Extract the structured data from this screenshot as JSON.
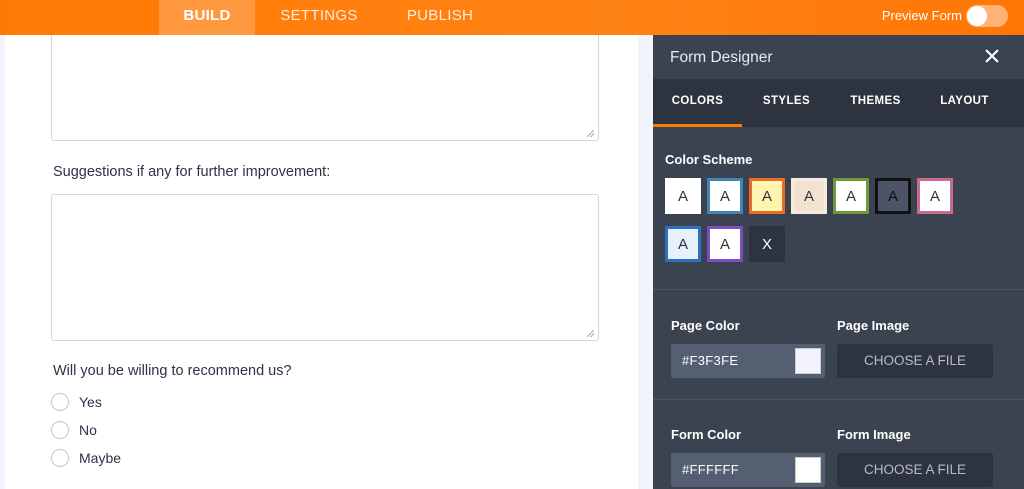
{
  "topbar": {
    "tabs": [
      {
        "label": "BUILD",
        "active": true
      },
      {
        "label": "SETTINGS",
        "active": false
      },
      {
        "label": "PUBLISH",
        "active": false
      }
    ],
    "preview_label": "Preview Form",
    "preview_enabled": false,
    "accent_color": "#ff7a05"
  },
  "form": {
    "page_background": "#f3f3fe",
    "questions": [
      {
        "label": "Suggestions if any for further improvement:",
        "type": "textarea"
      },
      {
        "label": "Will you be willing to recommend us?",
        "type": "radio",
        "options": [
          "Yes",
          "No",
          "Maybe"
        ]
      }
    ]
  },
  "designer": {
    "title": "Form Designer",
    "close_icon": "close-icon",
    "tabs": [
      {
        "label": "COLORS",
        "active": true
      },
      {
        "label": "STYLES",
        "active": false
      },
      {
        "label": "THEMES",
        "active": false
      },
      {
        "label": "LAYOUT",
        "active": false
      }
    ],
    "color_scheme": {
      "label": "Color Scheme",
      "swatches": [
        {
          "text": "A",
          "bg": "#ffffff",
          "border": "#ffffff",
          "fg": "#2c3345"
        },
        {
          "text": "A",
          "bg": "#ffffff",
          "border": "#3f86b5",
          "fg": "#2c3345"
        },
        {
          "text": "A",
          "bg": "#fff4b0",
          "border": "#e96b25",
          "fg": "#2c3345"
        },
        {
          "text": "A",
          "bg": "#f1e3d0",
          "border": "#f5ece1",
          "fg": "#2c3345"
        },
        {
          "text": "A",
          "bg": "#ffffff",
          "border": "#6d9a3b",
          "fg": "#2c3345"
        },
        {
          "text": "A",
          "bg": "#4c5466",
          "border": "#111111",
          "fg": "#111111"
        },
        {
          "text": "A",
          "bg": "#ffffff",
          "border": "#c96b8e",
          "fg": "#2c3345"
        },
        {
          "text": "A",
          "bg": "#e8f0fb",
          "border": "#2f6fc1",
          "fg": "#2c3345"
        },
        {
          "text": "A",
          "bg": "#ffffff",
          "border": "#7b4dc2",
          "fg": "#2c3345"
        },
        {
          "text": "X",
          "bg": "#2e343f",
          "border": "#2e343f",
          "fg": "#ffffff"
        }
      ]
    },
    "page_color": {
      "label": "Page Color",
      "value": "#F3F3FE"
    },
    "page_image": {
      "label": "Page Image",
      "button": "CHOOSE A FILE"
    },
    "form_color": {
      "label": "Form Color",
      "value": "#FFFFFF"
    },
    "form_image": {
      "label": "Form Image",
      "button": "CHOOSE A FILE"
    }
  }
}
